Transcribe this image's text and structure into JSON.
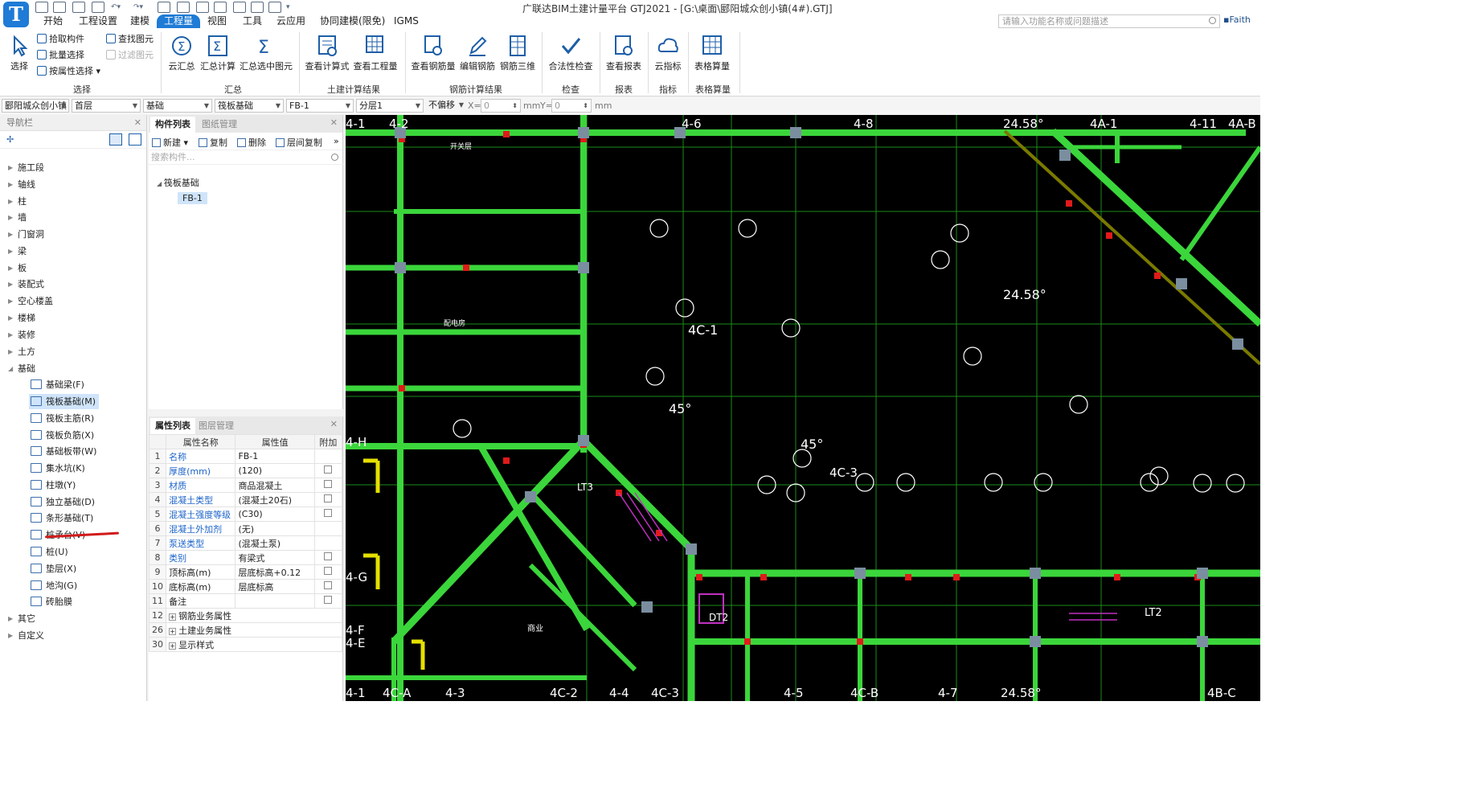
{
  "title_bar": {
    "logo_letter": "T",
    "app_title": "广联达BIM土建计量平台 GTJ2021 - [G:\\桌面\\郾阳城众创小镇(4#).GTJ]",
    "search_placeholder": "请输入功能名称或问题描述",
    "user": "Faith",
    "brand_color": "#1e7bd6"
  },
  "menu": [
    {
      "label": "开始"
    },
    {
      "label": "工程设置"
    },
    {
      "label": "建模"
    },
    {
      "label": "工程量",
      "active": true
    },
    {
      "label": "视图"
    },
    {
      "label": "工具"
    },
    {
      "label": "云应用"
    },
    {
      "label": "协同建模(限免)"
    },
    {
      "label": "IGMS"
    }
  ],
  "ribbon": {
    "select": {
      "big": "选择",
      "small": [
        "拾取构件",
        "批量选择",
        "按属性选择"
      ],
      "find": "查找图元",
      "filter": "过滤图元",
      "group": "选择"
    },
    "summary": {
      "items": [
        "云汇总",
        "汇总计算",
        "汇总选中图元"
      ],
      "group": "汇总"
    },
    "civil": {
      "items": [
        "查看计算式",
        "查看工程量"
      ],
      "group": "土建计算结果"
    },
    "rebar": {
      "items": [
        "查看钢筋量",
        "编辑钢筋",
        "钢筋三维"
      ],
      "group": "钢筋计算结果"
    },
    "check": {
      "items": [
        "合法性检查"
      ],
      "group": "检查"
    },
    "report": {
      "items": [
        "查看报表"
      ],
      "group": "报表"
    },
    "index": {
      "items": [
        "云指标"
      ],
      "group": "指标"
    },
    "table": {
      "items": [
        "表格算量"
      ],
      "group": "表格算量"
    }
  },
  "selector_bar": {
    "project": "郾阳城众创小镇",
    "floor": "首层",
    "category": "基础",
    "type": "筏板基础",
    "component": "FB-1",
    "layer": "分层1",
    "offset": "不偏移",
    "x_label": "X=",
    "x_value": "0",
    "y_label": "Y=",
    "y_value": "0",
    "unit": "mm"
  },
  "nav": {
    "header": "导航栏",
    "items": [
      "施工段",
      "轴线",
      "柱",
      "墙",
      "门窗洞",
      "梁",
      "板",
      "装配式",
      "空心楼盖",
      "楼梯",
      "装修",
      "土方",
      "基础",
      "其它",
      "自定义"
    ],
    "expanded": "基础",
    "sub_items": [
      "基础梁(F)",
      "筏板基础(M)",
      "筏板主筋(R)",
      "筏板负筋(X)",
      "基础板带(W)",
      "集水坑(K)",
      "柱墩(Y)",
      "独立基础(D)",
      "条形基础(T)",
      "桩承台(V)",
      "桩(U)",
      "垫层(X)",
      "地沟(G)",
      "砖胎膜"
    ],
    "selected_sub": "筏板基础(M)"
  },
  "component_list": {
    "tabs": [
      "构件列表",
      "图纸管理"
    ],
    "toolbar": [
      "新建",
      "复制",
      "删除",
      "层间复制"
    ],
    "search_placeholder": "搜索构件...",
    "tree_root": "筏板基础",
    "tree_child": "FB-1"
  },
  "properties": {
    "tabs": [
      "属性列表",
      "图层管理"
    ],
    "headers": [
      "属性名称",
      "属性值",
      "附加"
    ],
    "rows": [
      {
        "no": "1",
        "name": "名称",
        "value": "FB-1",
        "blue": true,
        "check": false
      },
      {
        "no": "2",
        "name": "厚度(mm)",
        "value": "(120)",
        "blue": true,
        "check": true
      },
      {
        "no": "3",
        "name": "材质",
        "value": "商品混凝土",
        "blue": true,
        "check": true
      },
      {
        "no": "4",
        "name": "混凝土类型",
        "value": "(混凝土20石)",
        "blue": true,
        "check": true
      },
      {
        "no": "5",
        "name": "混凝土强度等级",
        "value": "(C30)",
        "blue": true,
        "check": true
      },
      {
        "no": "6",
        "name": "混凝土外加剂",
        "value": "(无)",
        "blue": true,
        "check": false
      },
      {
        "no": "7",
        "name": "泵送类型",
        "value": "(混凝土泵)",
        "blue": true,
        "check": false
      },
      {
        "no": "8",
        "name": "类别",
        "value": "有梁式",
        "blue": true,
        "check": true
      },
      {
        "no": "9",
        "name": "顶标高(m)",
        "value": "层底标高+0.12",
        "blue": false,
        "check": true
      },
      {
        "no": "10",
        "name": "底标高(m)",
        "value": "层底标高",
        "blue": false,
        "check": true
      },
      {
        "no": "11",
        "name": "备注",
        "value": "",
        "blue": false,
        "check": true
      },
      {
        "no": "12",
        "name": "钢筋业务属性",
        "value": "",
        "group": true
      },
      {
        "no": "26",
        "name": "土建业务属性",
        "value": "",
        "group": true
      },
      {
        "no": "30",
        "name": "显示样式",
        "value": "",
        "group": true
      }
    ]
  },
  "canvas": {
    "axis_top": [
      "4-1",
      "4-2",
      "4-6",
      "4-8",
      "24.58°",
      "4A-1",
      "4-11",
      "4A-B"
    ],
    "axis_bottom": [
      "4-1",
      "4C-A",
      "4-3",
      "4C-2",
      "4-4",
      "4C-3",
      "4-5",
      "4C-B",
      "4-7",
      "24.58°",
      "4B-C"
    ],
    "axis_left": [
      "4-H",
      "4-G",
      "4-F",
      "4-E"
    ],
    "labels": [
      "4C-1",
      "45°",
      "45°",
      "4C-3",
      "24.58°",
      "LT3",
      "LT2",
      "DT2",
      "开关层",
      "配电房",
      "商业"
    ],
    "grid_color": "#3bd63b",
    "background": "#000000"
  }
}
